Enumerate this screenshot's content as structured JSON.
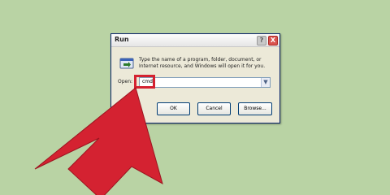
{
  "dialog": {
    "title": "Run",
    "description": "Type the name of a program, folder, document, or Internet resource, and Windows will open it for you.",
    "open_label": "Open:",
    "open_value": "cmd",
    "ok_label": "OK",
    "cancel_label": "Cancel",
    "browse_label": "Browse...",
    "help_label": "?",
    "close_label": "X"
  },
  "colors": {
    "background": "#b9d3a4",
    "arrow": "#d42231",
    "highlight": "#d42231"
  },
  "icons": [
    "run-icon",
    "help-icon",
    "close-icon",
    "chevron-down-icon",
    "pointer-arrow-icon"
  ]
}
